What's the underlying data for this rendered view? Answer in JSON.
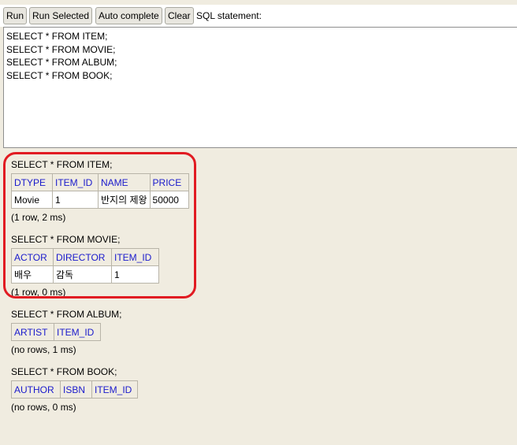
{
  "toolbar": {
    "run_label": "Run",
    "run_selected_label": "Run Selected",
    "auto_complete_label": "Auto complete",
    "clear_label": "Clear",
    "sql_statement_label": "SQL statement:"
  },
  "editor": {
    "lines": [
      "SELECT * FROM ITEM;",
      "SELECT * FROM MOVIE;",
      "SELECT * FROM ALBUM;",
      "SELECT * FROM BOOK;"
    ]
  },
  "results": [
    {
      "sql": "SELECT * FROM ITEM;",
      "columns": [
        "DTYPE",
        "ITEM_ID",
        "NAME",
        "PRICE"
      ],
      "rows": [
        [
          "Movie",
          "1",
          "반지의 제왕",
          "50000"
        ]
      ],
      "status": "(1 row, 2 ms)"
    },
    {
      "sql": "SELECT * FROM MOVIE;",
      "columns": [
        "ACTOR",
        "DIRECTOR",
        "ITEM_ID"
      ],
      "rows": [
        [
          "배우",
          "감독",
          "1"
        ]
      ],
      "status": "(1 row, 0 ms)"
    },
    {
      "sql": "SELECT * FROM ALBUM;",
      "columns": [
        "ARTIST",
        "ITEM_ID"
      ],
      "rows": [],
      "status": "(no rows, 1 ms)"
    },
    {
      "sql": "SELECT * FROM BOOK;",
      "columns": [
        "AUTHOR",
        "ISBN",
        "ITEM_ID"
      ],
      "rows": [],
      "status": "(no rows, 0 ms)"
    }
  ],
  "colors": {
    "panel_background": "#f0ece0",
    "header_text": "#1a1acc",
    "highlight_border": "#e11b22"
  }
}
